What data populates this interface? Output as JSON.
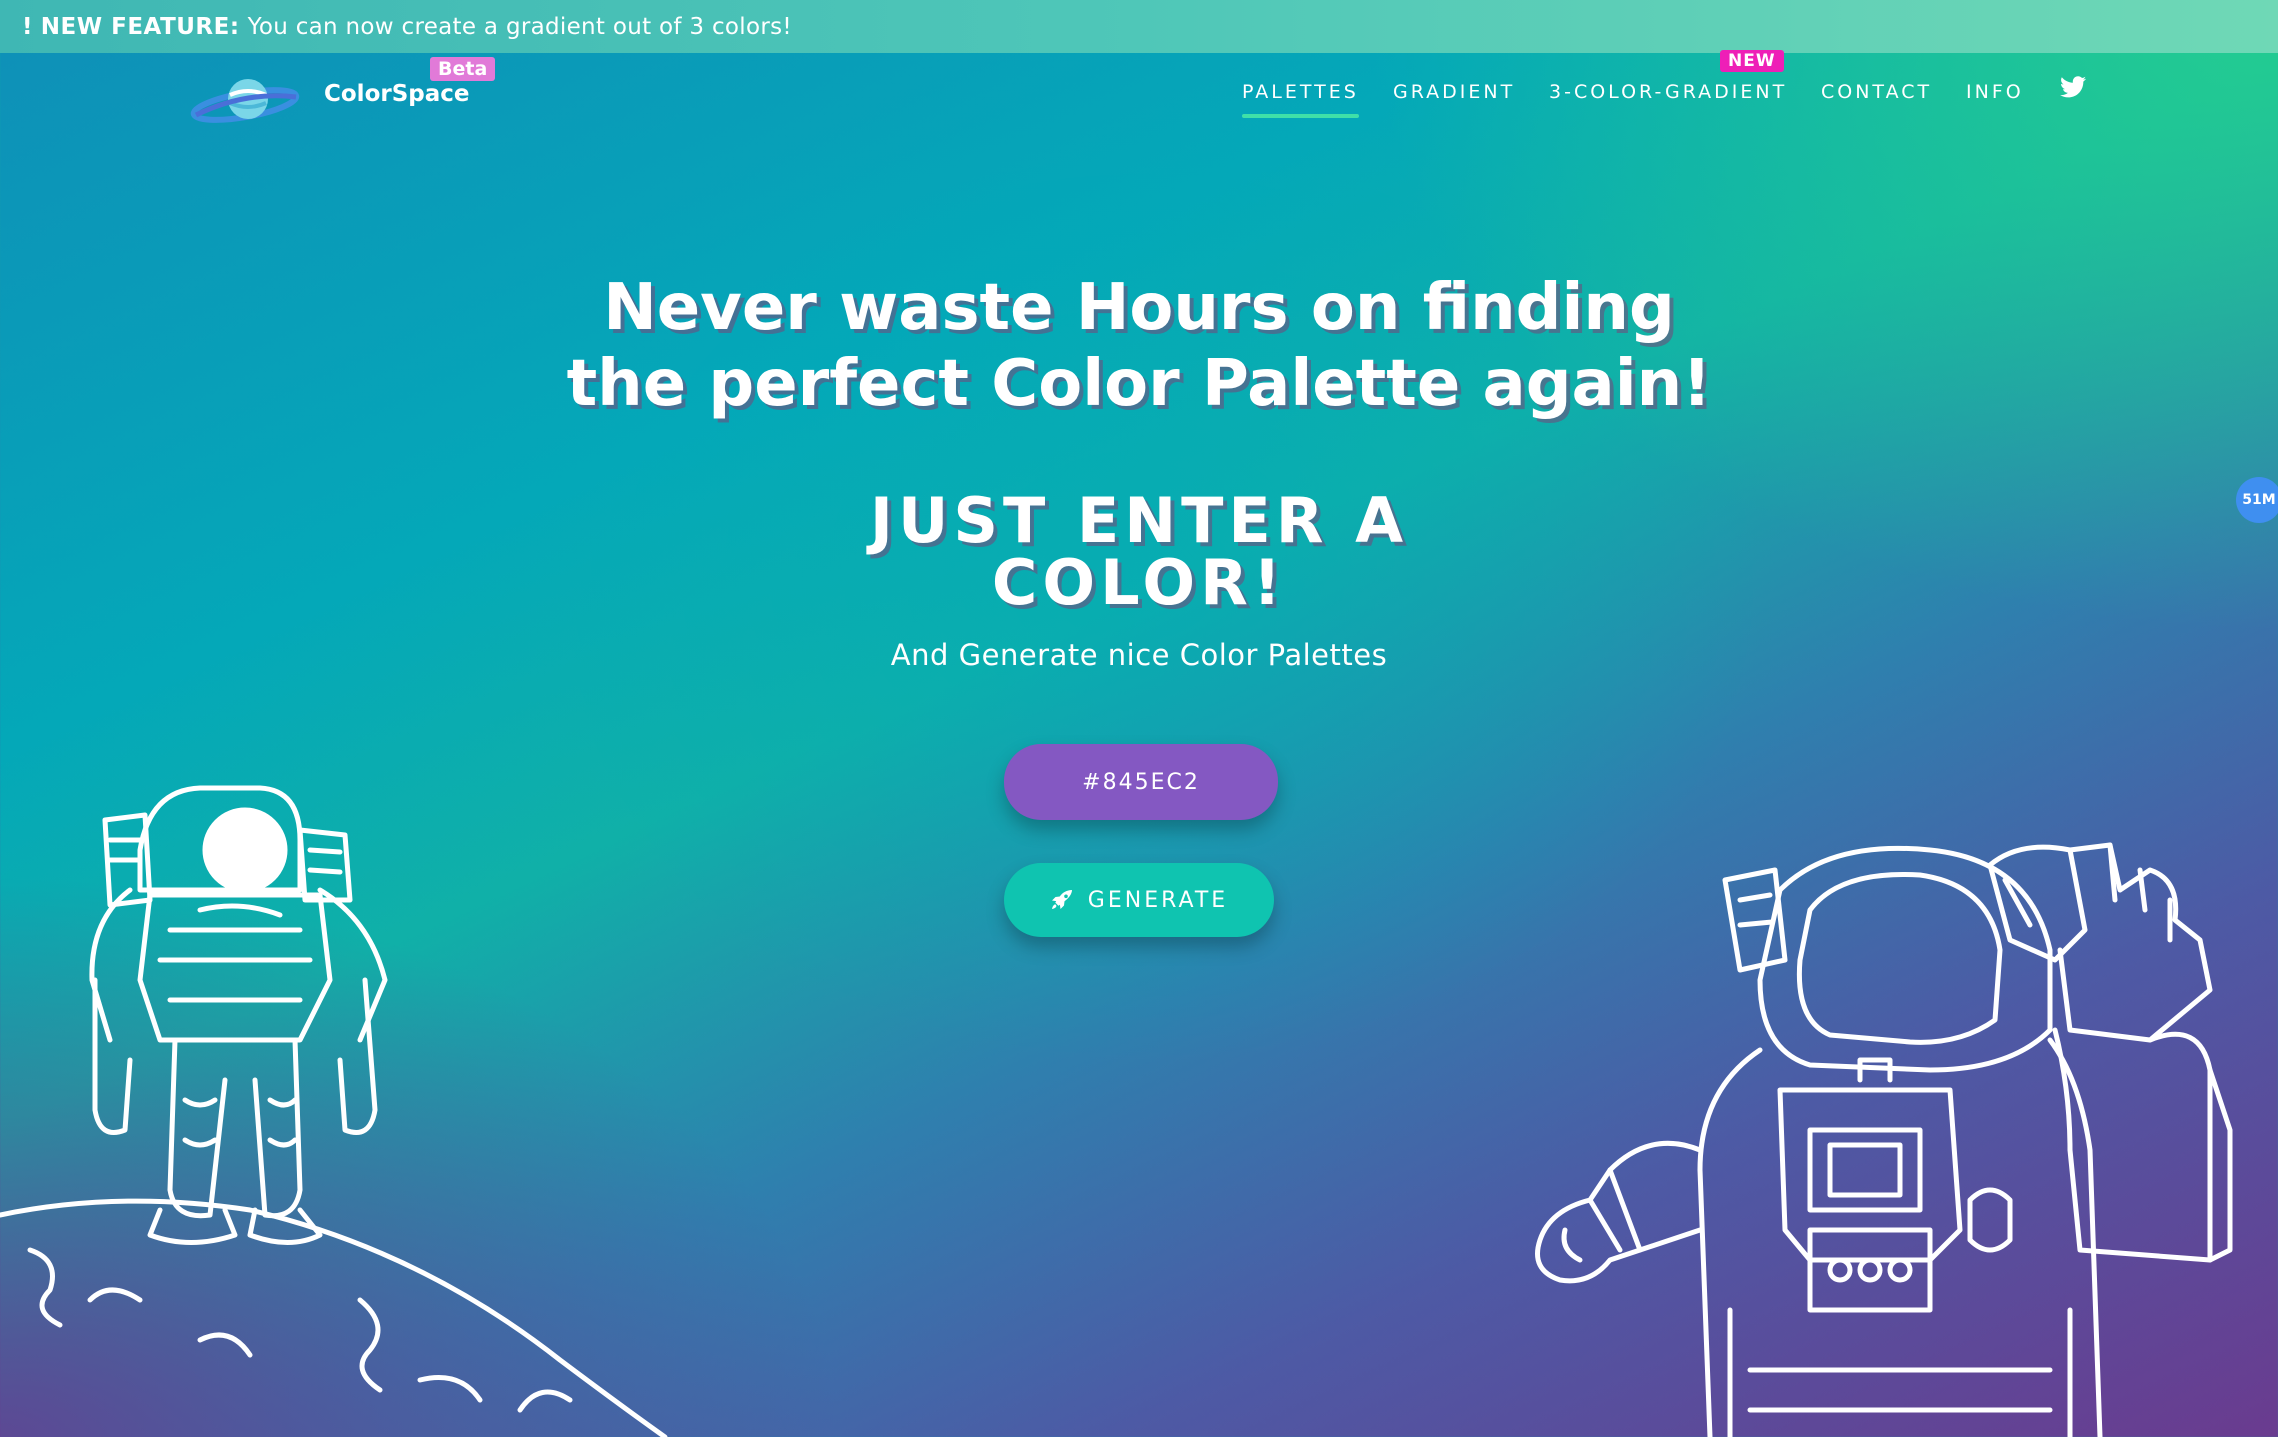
{
  "banner": {
    "bang": "!",
    "label": "NEW FEATURE:",
    "message": "You can now create a gradient out of 3 colors!"
  },
  "nav": {
    "brand": "ColorSpace",
    "beta_badge": "Beta",
    "links": [
      {
        "label": "PALETTES",
        "active": true
      },
      {
        "label": "GRADIENT",
        "active": false
      },
      {
        "label": "3-COLOR-GRADIENT",
        "active": false
      },
      {
        "label": "CONTACT",
        "active": false
      },
      {
        "label": "INFO",
        "active": false
      }
    ],
    "new_badge": "NEW",
    "social_icon": "twitter-icon"
  },
  "hero": {
    "title_line1": "Never waste Hours on finding",
    "title_line2": "the perfect Color Palette again!",
    "subtitle_line1": "JUST ENTER A",
    "subtitle_line2": "COLOR!",
    "tagline": "And Generate nice Color Palettes",
    "color_value": "#845EC2",
    "generate_label": "GENERATE"
  },
  "side_badge": "51M",
  "colors": {
    "input_bg": "#8458c2",
    "generate_bg": "#0fc4b0",
    "active_underline": "#3fe0a8",
    "beta_badge": "#e17ad8",
    "new_badge": "#ee1fb7"
  }
}
